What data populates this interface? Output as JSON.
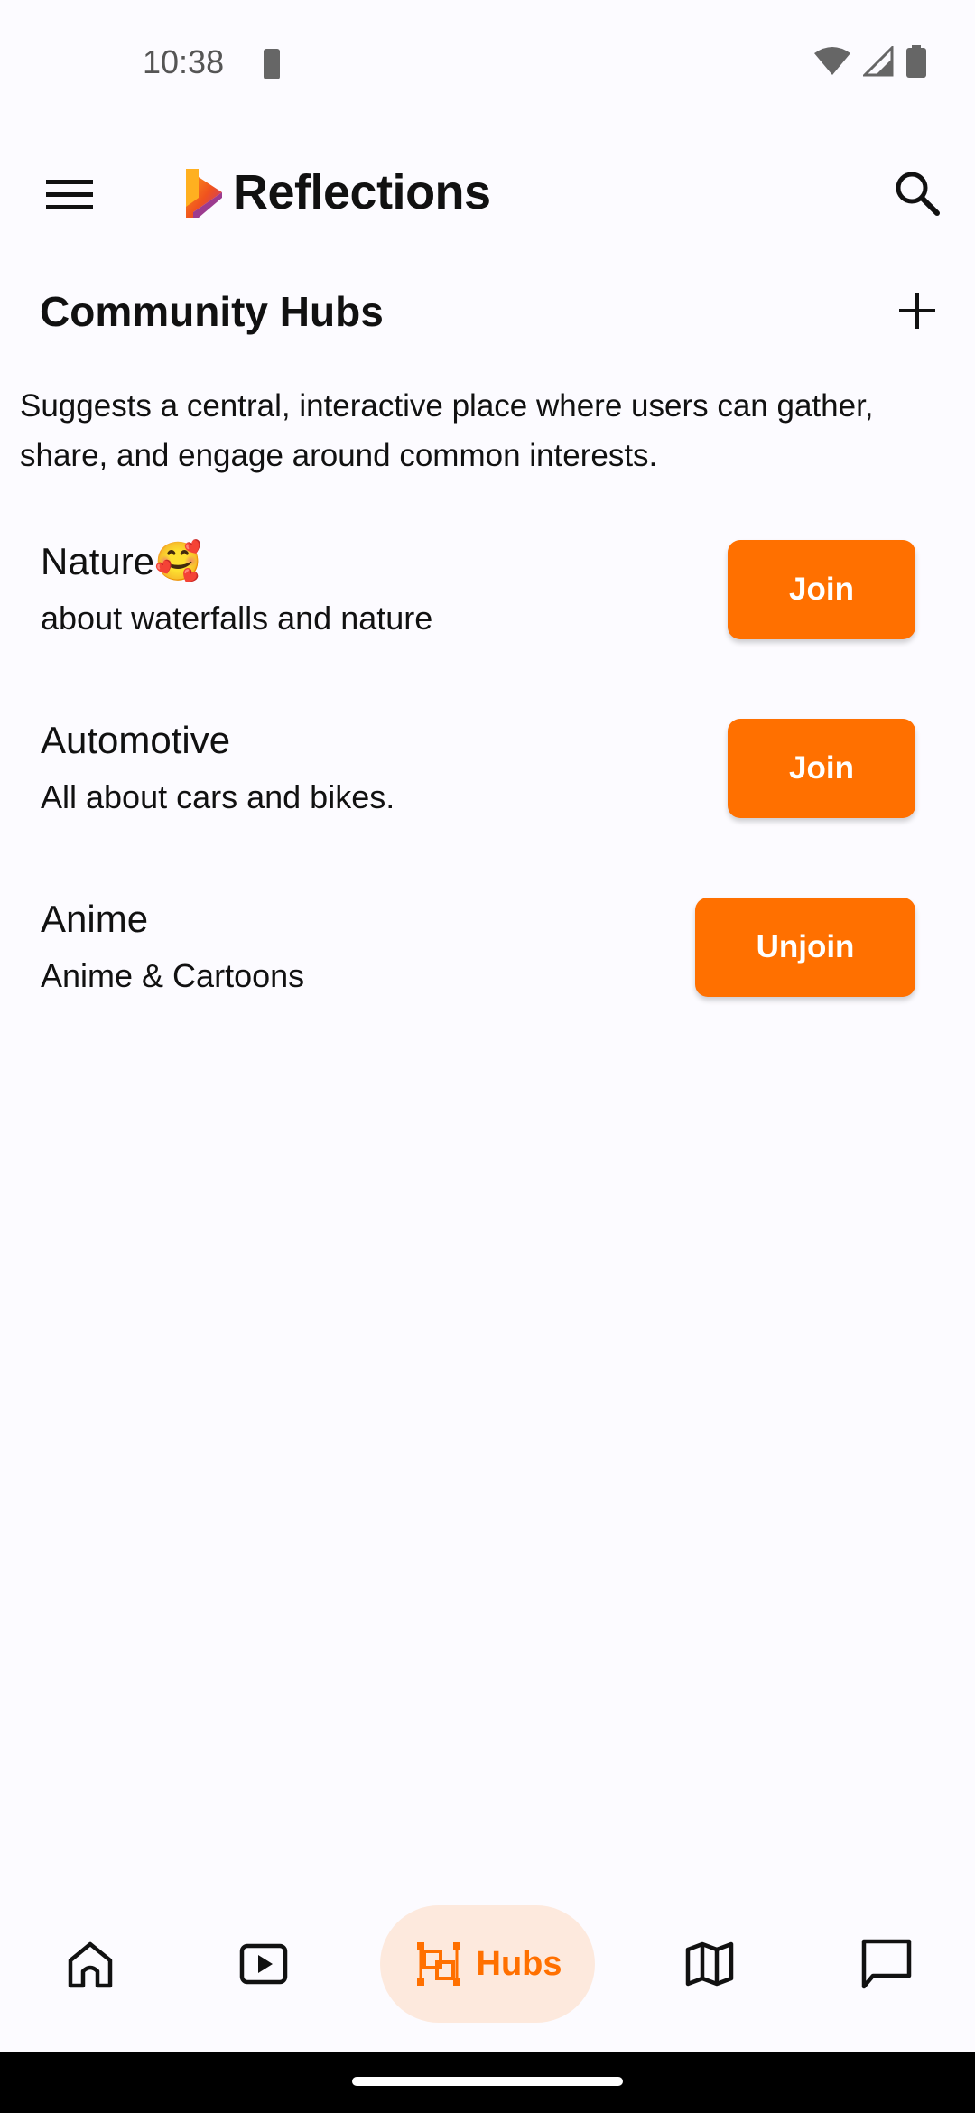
{
  "status_bar": {
    "time": "10:38",
    "icons": [
      "battery-saver-icon",
      "wifi-icon",
      "cell-signal-icon",
      "battery-icon"
    ]
  },
  "app_bar": {
    "title": "Reflections",
    "icons": [
      "menu-icon",
      "logo-icon",
      "search-icon"
    ]
  },
  "section": {
    "title": "Community Hubs",
    "description": "Suggests a central, interactive place where users can gather, share, and engage around common interests.",
    "add_icon": "add-icon"
  },
  "hubs": [
    {
      "name": "Nature🥰",
      "description": "about waterfalls and nature",
      "button_label": "Join"
    },
    {
      "name": "Automotive",
      "description": "All about cars and bikes.",
      "button_label": "Join"
    },
    {
      "name": "Anime",
      "description": "Anime & Cartoons",
      "button_label": "Unjoin"
    }
  ],
  "bottom_nav": {
    "items": [
      {
        "icon": "home-icon"
      },
      {
        "icon": "video-icon"
      },
      {
        "icon": "hubs-icon",
        "label": "Hubs",
        "active": true
      },
      {
        "icon": "map-icon"
      },
      {
        "icon": "chat-icon"
      }
    ]
  },
  "colors": {
    "accent": "#ff7000",
    "accent_soft": "#fde9dd",
    "background": "#fcfbff",
    "text": "#111111"
  }
}
